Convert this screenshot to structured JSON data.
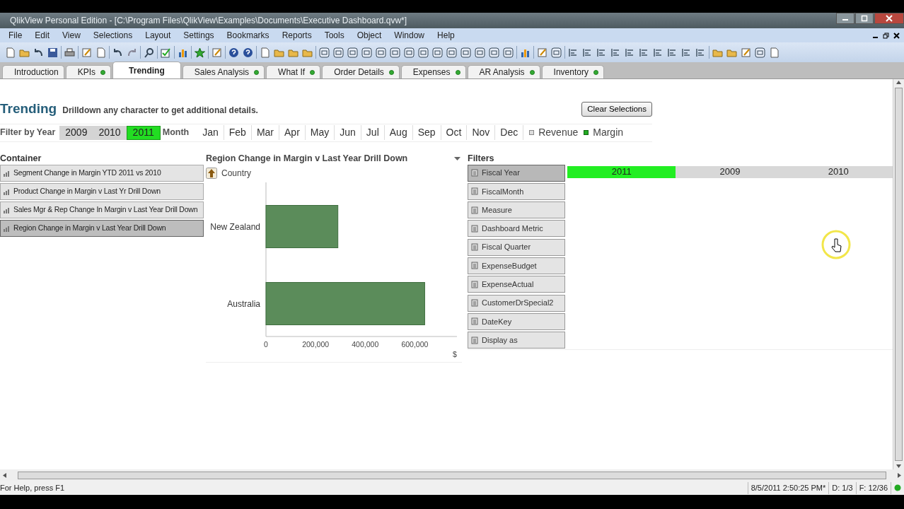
{
  "window": {
    "title": "QlikView Personal Edition - [C:\\Program Files\\QlikView\\Examples\\Documents\\Executive Dashboard.qvw*]"
  },
  "menu": [
    "File",
    "Edit",
    "View",
    "Selections",
    "Layout",
    "Settings",
    "Bookmarks",
    "Reports",
    "Tools",
    "Object",
    "Window",
    "Help"
  ],
  "tabs": [
    {
      "label": "Introduction",
      "selected": false,
      "indicator": false
    },
    {
      "label": "KPIs",
      "selected": false,
      "indicator": true
    },
    {
      "label": "Trending",
      "selected": true,
      "indicator": false
    },
    {
      "label": "Sales Analysis",
      "selected": false,
      "indicator": true
    },
    {
      "label": "What If",
      "selected": false,
      "indicator": true
    },
    {
      "label": "Order Details",
      "selected": false,
      "indicator": true
    },
    {
      "label": "Expenses",
      "selected": false,
      "indicator": true
    },
    {
      "label": "AR Analysis",
      "selected": false,
      "indicator": true
    },
    {
      "label": "Inventory",
      "selected": false,
      "indicator": true
    }
  ],
  "sheet": {
    "title": "Trending",
    "subtitle": "Drilldown any character to get additional details.",
    "clear_button": "Clear Selections",
    "year_label": "Filter by Year",
    "month_label": "Month",
    "years": [
      {
        "label": "2009",
        "selected": false
      },
      {
        "label": "2010",
        "selected": false
      },
      {
        "label": "2011",
        "selected": true
      }
    ],
    "months": [
      {
        "label": "Jan",
        "selected": false
      },
      {
        "label": "Feb",
        "selected": false
      },
      {
        "label": "Mar",
        "selected": false
      },
      {
        "label": "Apr",
        "selected": false
      },
      {
        "label": "May",
        "selected": false
      },
      {
        "label": "Jun",
        "selected": false
      },
      {
        "label": "Jul",
        "selected": false
      },
      {
        "label": "Aug",
        "selected": false
      },
      {
        "label": "Sep",
        "selected": false
      },
      {
        "label": "Oct",
        "selected": false
      },
      {
        "label": "Nov",
        "selected": false
      },
      {
        "label": "Dec",
        "selected": false
      }
    ],
    "measures": [
      {
        "label": "Revenue",
        "selected": false
      },
      {
        "label": "Margin",
        "selected": true
      }
    ]
  },
  "container": {
    "title": "Container",
    "items": [
      {
        "label": "Segment Change in Margin YTD 2011 vs 2010",
        "selected": false
      },
      {
        "label": "Product Change in Margin v Last Yr Drill Down",
        "selected": false
      },
      {
        "label": "Sales Mgr & Rep Change In Margin v Last Year Drill Down",
        "selected": false
      },
      {
        "label": "Region Change in Margin v Last Year Drill Down",
        "selected": true
      }
    ]
  },
  "chart": {
    "title": "Region Change in Margin v Last Year Drill Down",
    "drill_label": "Country",
    "chart_data": {
      "type": "bar",
      "orientation": "horizontal",
      "xlabel": "$",
      "categories": [
        "New Zealand",
        "Australia"
      ],
      "values": [
        290000,
        640000
      ],
      "xlim": [
        0,
        770000
      ],
      "xticks": [
        {
          "value": 0,
          "label": "0"
        },
        {
          "value": 200000,
          "label": "200,000"
        },
        {
          "value": 400000,
          "label": "400,000"
        },
        {
          "value": 600000,
          "label": "600,000"
        }
      ]
    }
  },
  "filters": {
    "title": "Filters",
    "fields": [
      {
        "label": "Fiscal Year",
        "selected": true
      },
      {
        "label": "FiscalMonth",
        "selected": false
      },
      {
        "label": "Measure",
        "selected": false
      },
      {
        "label": "Dashboard Metric",
        "selected": false
      },
      {
        "label": "Fiscal Quarter",
        "selected": false
      },
      {
        "label": "ExpenseBudget",
        "selected": false
      },
      {
        "label": "ExpenseActual",
        "selected": false
      },
      {
        "label": "CustomerDrSpecial2",
        "selected": false
      },
      {
        "label": "DateKey",
        "selected": false
      },
      {
        "label": "Display as",
        "selected": false
      }
    ],
    "values": [
      {
        "label": "2011",
        "selected": true
      },
      {
        "label": "2009",
        "selected": false
      },
      {
        "label": "2010",
        "selected": false
      }
    ]
  },
  "status_bar": {
    "help": "For Help, press F1",
    "timestamp": "8/5/2011 2:50:25 PM*",
    "document": "D: 1/3",
    "fields": "F: 12/36"
  }
}
